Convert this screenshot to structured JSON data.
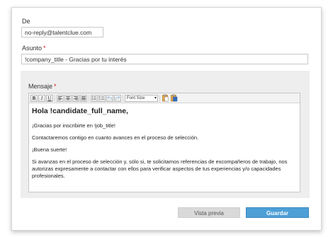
{
  "form": {
    "from_label": "De",
    "from_value": "no-reply@talentclue.com",
    "subject_label": "Asunto",
    "subject_required": "*",
    "subject_value": "!company_title - Gracias por tu interés",
    "message_label": "Mensaje",
    "message_required": "*"
  },
  "toolbar": {
    "bold": "B",
    "italic": "I",
    "underline": "U",
    "font_size_value": "Font Size",
    "icons": [
      "bold-icon",
      "italic-icon",
      "underline-icon",
      "align-left-icon",
      "align-center-icon",
      "align-right-icon",
      "align-justify-icon",
      "bullet-list-icon",
      "numbered-list-icon",
      "undo-icon",
      "redo-icon",
      "font-size-select",
      "paste-icon",
      "paste-word-icon"
    ]
  },
  "message": {
    "heading": "Hola !candidate_full_name,",
    "p1": "¡Gracias por inscribirte en !job_title!",
    "p2": "Contactaremos contigo en cuanto avances en el proceso de selección.",
    "p3": "¡Buena suerte!",
    "p4": "Si avanzas en el proceso de selección y, sólo si, te solicitamos referencias de excompañeros de trabajo, nos autorizas expresamente a contactar con ellos para verificar aspectos de tus experiencias y/o capacidades profesionales."
  },
  "actions": {
    "preview_label": "Vista previa",
    "save_label": "Guardar"
  },
  "colors": {
    "required": "#d9221b",
    "save_button": "#4d9fd6",
    "panel_bg": "#eeeeee"
  }
}
